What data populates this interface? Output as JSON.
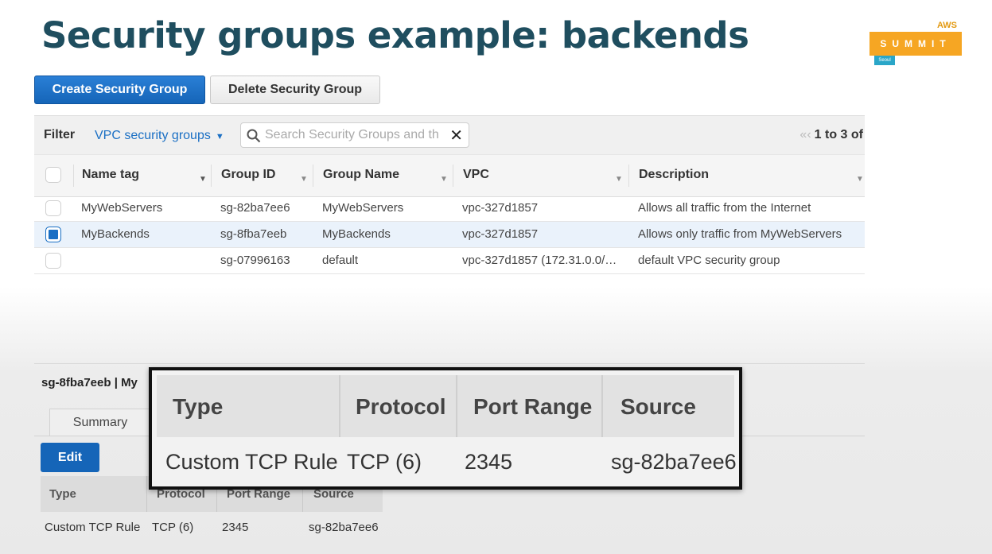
{
  "slide": {
    "title": "Security groups example: backends",
    "logo": {
      "top": "AWS",
      "main": "SUMMIT",
      "sub": "Seoul"
    }
  },
  "toolbar": {
    "create_label": "Create Security Group",
    "delete_label": "Delete Security Group"
  },
  "filter": {
    "label": "Filter",
    "selected": "VPC security groups",
    "search_placeholder": "Search Security Groups and th",
    "pager": "1 to 3 of"
  },
  "table": {
    "columns": [
      "Name tag",
      "Group ID",
      "Group Name",
      "VPC",
      "Description"
    ],
    "rows": [
      {
        "checked": false,
        "name_tag": "MyWebServers",
        "group_id": "sg-82ba7ee6",
        "group_name": "MyWebServers",
        "vpc": "vpc-327d1857",
        "description": "Allows all traffic from the Internet"
      },
      {
        "checked": true,
        "name_tag": "MyBackends",
        "group_id": "sg-8fba7eeb",
        "group_name": "MyBackends",
        "vpc": "vpc-327d1857",
        "description": "Allows only traffic from MyWebServers"
      },
      {
        "checked": false,
        "name_tag": "",
        "group_id": "sg-07996163",
        "group_name": "default",
        "vpc": "vpc-327d1857 (172.31.0.0/…",
        "description": "default VPC security group"
      }
    ]
  },
  "details": {
    "title": "sg-8fba7eeb | My",
    "tab_summary": "Summary",
    "edit_label": "Edit",
    "columns": [
      "Type",
      "Protocol",
      "Port Range",
      "Source"
    ],
    "rule": {
      "type": "Custom TCP Rule",
      "protocol": "TCP (6)",
      "port_range": "2345",
      "source": "sg-82ba7ee6"
    }
  },
  "callout": {
    "columns": [
      "Type",
      "Protocol",
      "Port Range",
      "Source"
    ],
    "rule": {
      "type": "Custom TCP Rule",
      "protocol": "TCP (6)",
      "port_range": "2345",
      "source": "sg-82ba7ee6"
    }
  },
  "colors": {
    "title": "#1f4e5f",
    "primary": "#1565b8",
    "link": "#1a6fc4",
    "logo": "#f6a623"
  }
}
